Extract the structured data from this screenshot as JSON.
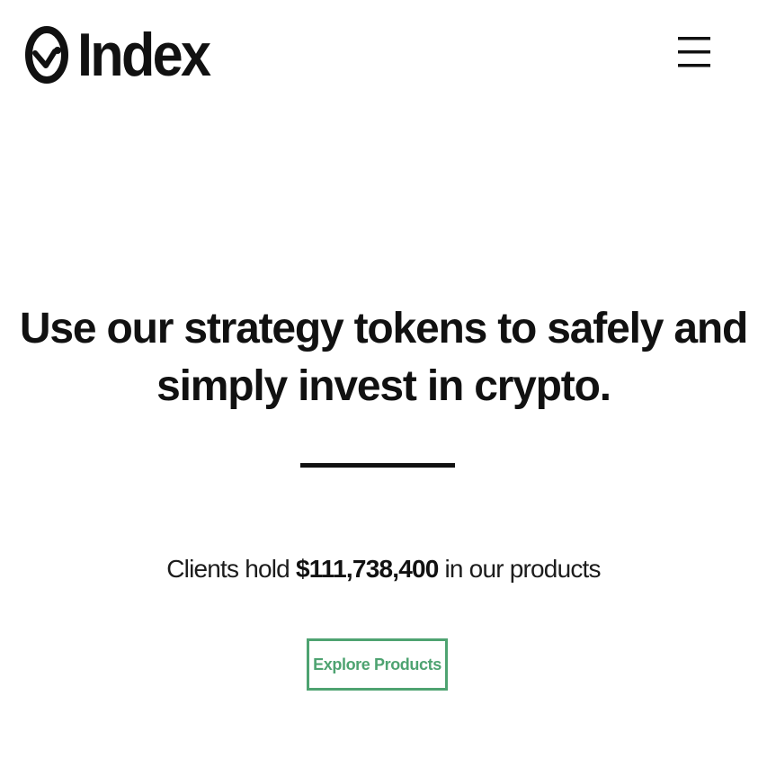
{
  "header": {
    "logo_text": "Index",
    "logo_icon": "index-logo-icon",
    "menu_icon": "hamburger-menu-icon"
  },
  "hero": {
    "heading": "Use our strategy tokens to safely and simply invest in crypto.",
    "stat_prefix": "Clients hold ",
    "stat_amount": "$111,738,400",
    "stat_suffix": " in our products",
    "cta_label": "Explore Products"
  },
  "colors": {
    "text": "#111111",
    "background": "#ffffff",
    "accent": "#4ea371"
  }
}
